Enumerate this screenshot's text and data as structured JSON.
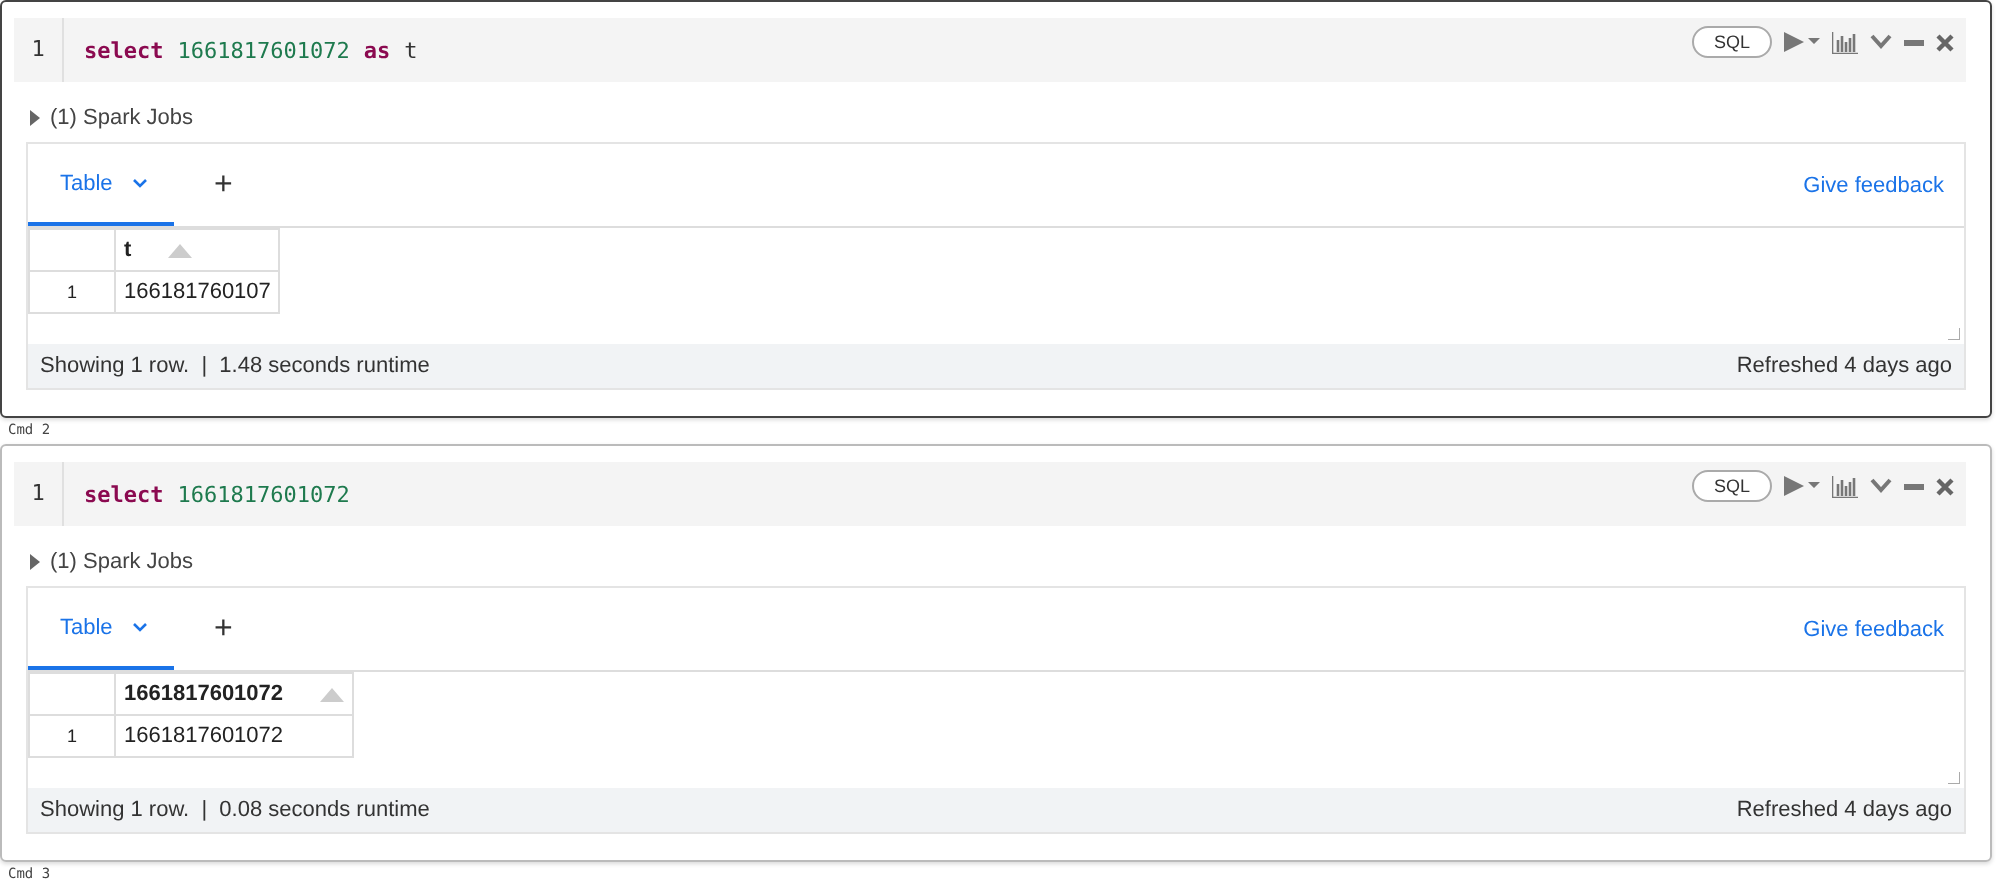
{
  "cells": [
    {
      "selected": true,
      "line_number": "1",
      "code": [
        {
          "kind": "keyword",
          "text": "select"
        },
        {
          "kind": "number",
          "text": "1661817601072"
        },
        {
          "kind": "keyword",
          "text": "as"
        },
        {
          "kind": "plain",
          "text": "t"
        }
      ],
      "language": "SQL",
      "jobs": "(1) Spark Jobs",
      "tabs": [
        {
          "label": "Table",
          "selected": true
        }
      ],
      "add_tab": "+",
      "feedback": "Give feedback",
      "columns": [
        "",
        "t"
      ],
      "rows": [
        [
          "1",
          "166181760107"
        ]
      ],
      "status": "Showing 1 row.  |  1.48 seconds runtime",
      "refreshed": "Refreshed 4 days ago",
      "cmd": "Cmd 2"
    },
    {
      "selected": false,
      "line_number": "1",
      "code": [
        {
          "kind": "keyword",
          "text": "select"
        },
        {
          "kind": "number",
          "text": "1661817601072"
        }
      ],
      "language": "SQL",
      "jobs": "(1) Spark Jobs",
      "tabs": [
        {
          "label": "Table",
          "selected": true
        }
      ],
      "add_tab": "+",
      "feedback": "Give feedback",
      "columns": [
        "",
        "1661817601072"
      ],
      "rows": [
        [
          "1",
          "1661817601072"
        ]
      ],
      "status": "Showing 1 row.  |  0.08 seconds runtime",
      "refreshed": "Refreshed 4 days ago",
      "cmd": "Cmd 3"
    }
  ]
}
